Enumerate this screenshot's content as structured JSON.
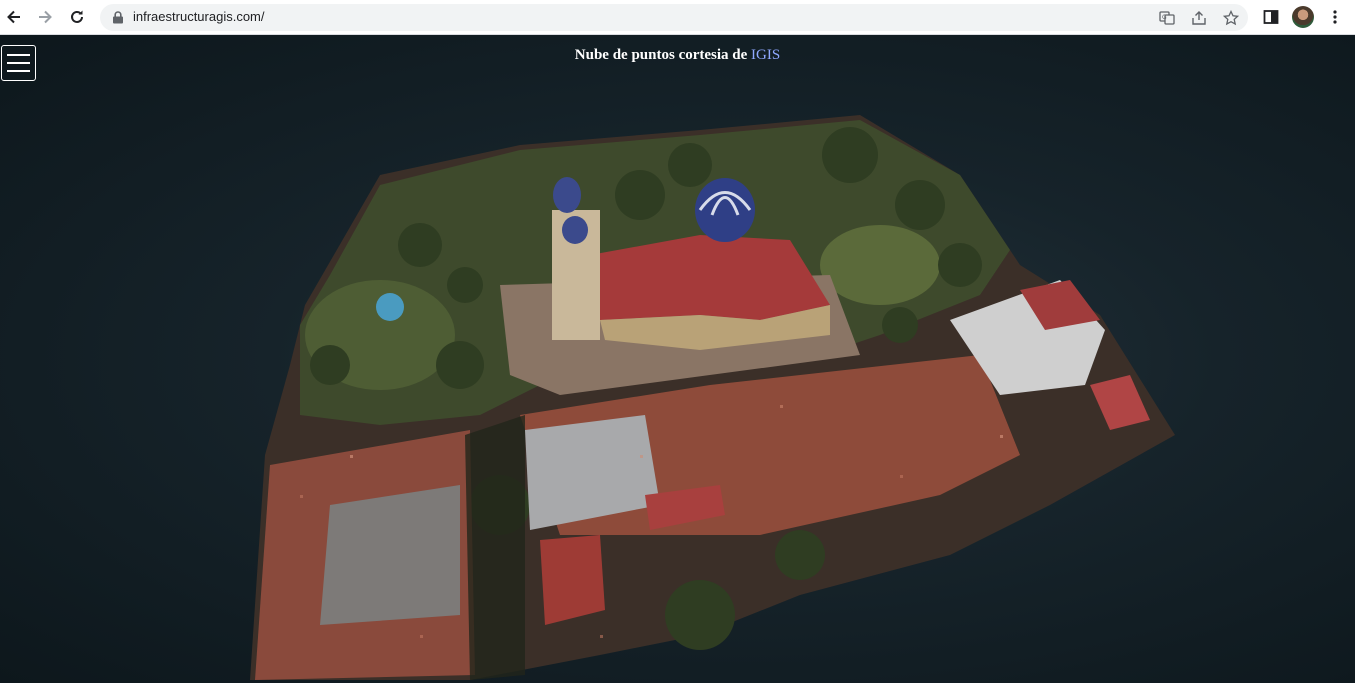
{
  "browser": {
    "url": "infraestructuragis.com/",
    "icons": {
      "back": "arrow-left-icon",
      "forward": "arrow-right-icon",
      "reload": "reload-icon",
      "lock": "lock-icon",
      "translate": "translate-icon",
      "share": "share-icon",
      "bookmark": "star-icon",
      "side_panel": "side-panel-icon",
      "menu": "kebab-menu-icon"
    }
  },
  "page": {
    "credit_text": "Nube de puntos cortesia de",
    "credit_link": "IGIS",
    "menu_icon": "hamburger-icon",
    "colors": {
      "background": "#16232a",
      "credit_link": "#8fa8ff"
    }
  }
}
